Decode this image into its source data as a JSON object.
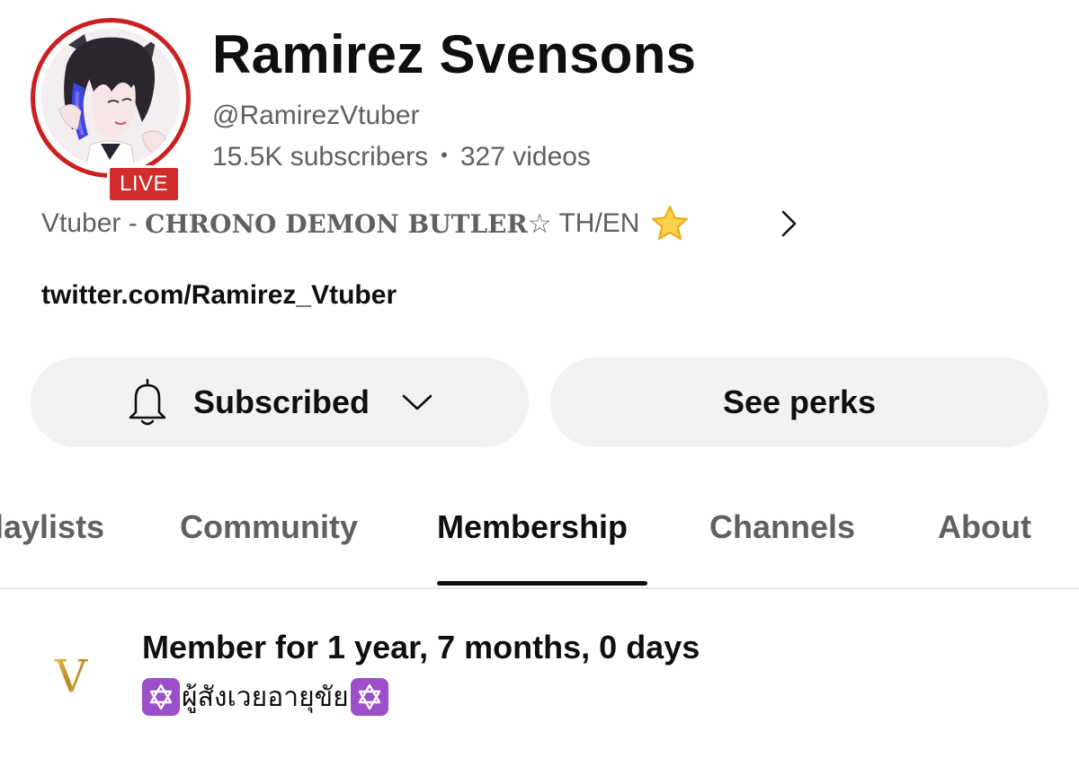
{
  "channel": {
    "name": "Ramirez Svensons",
    "handle": "@RamirezVtuber",
    "subscribers": "15.5K subscribers",
    "separator": "•",
    "videos": "327 videos",
    "live_badge": "LIVE",
    "description_prefix": "Vtuber - ",
    "description_title": "CHRONO DEMON BUTLER",
    "description_star": "☆",
    "description_suffix": " TH/EN",
    "link": "twitter.com/Ramirez_Vtuber"
  },
  "buttons": {
    "subscribed": "Subscribed",
    "see_perks": "See perks"
  },
  "tabs": [
    {
      "label": "laylists",
      "active": false
    },
    {
      "label": "Community",
      "active": false
    },
    {
      "label": "Membership",
      "active": true
    },
    {
      "label": "Channels",
      "active": false
    },
    {
      "label": "About",
      "active": false
    }
  ],
  "membership": {
    "icon_letter": "V",
    "title": "Member for 1 year, 7 months, 0 days",
    "badge_text": "ผู้สังเวยอายุขัย"
  },
  "colors": {
    "live_red": "#d22c2c",
    "ring_red": "#cc2020",
    "button_bg": "#f2f2f2",
    "badge_purple": "#9b4fc9",
    "gold": "#c9a23a"
  },
  "icons": [
    "bell-icon",
    "chevron-down-icon",
    "chevron-right-icon",
    "star-icon",
    "star-of-david-icon",
    "v-emblem-icon"
  ]
}
